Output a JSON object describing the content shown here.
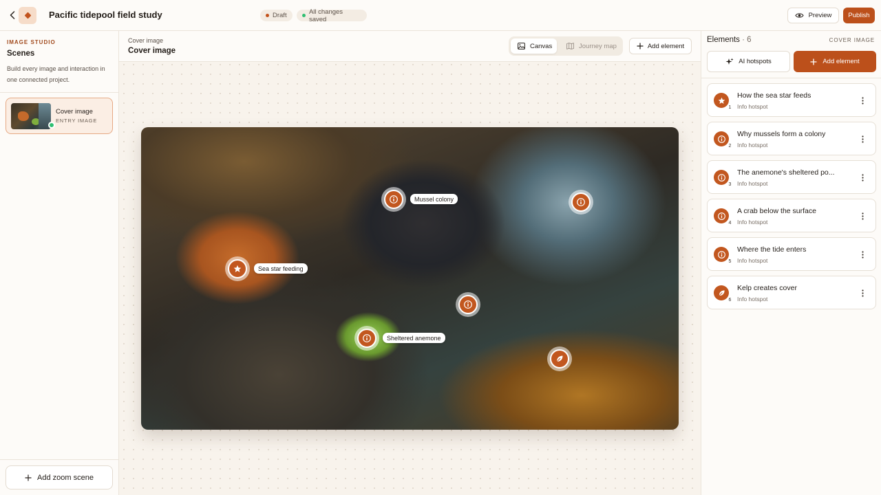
{
  "topbar": {
    "project_title": "Pacific tidepool field study",
    "status_draft": "Draft",
    "status_saved": "All changes saved",
    "preview_label": "Preview",
    "publish_label": "Publish"
  },
  "sidebar": {
    "section_label": "IMAGE STUDIO",
    "heading": "Scenes",
    "description": "Build every image and interaction in one connected project.",
    "scenes": [
      {
        "name": "Cover image",
        "subtitle": "ENTRY IMAGE"
      }
    ],
    "add_zoom_label": "Add zoom scene"
  },
  "canvas_header": {
    "breadcrumb": "Cover image",
    "title": "Cover image",
    "toggle_canvas": "Canvas",
    "toggle_journey": "Journey map",
    "add_element_label": "Add element"
  },
  "hotspots": [
    {
      "label": "Mussel colony",
      "icon": "info-icon"
    },
    {
      "label": "",
      "icon": "info-icon"
    },
    {
      "label": "Sea star feeding",
      "icon": "star-icon"
    },
    {
      "label": "",
      "icon": "info-icon"
    },
    {
      "label": "Sheltered anemone",
      "icon": "info-icon"
    },
    {
      "label": "",
      "icon": "leaf-icon"
    }
  ],
  "elements_panel": {
    "heading": "Elements",
    "count": "· 6",
    "scope": "COVER IMAGE",
    "ai_label": "AI hotspots",
    "add_label": "Add element",
    "items": [
      {
        "number": "1",
        "title": "How the sea star feeds",
        "type": "Info hotspot",
        "icon": "star-icon"
      },
      {
        "number": "2",
        "title": "Why mussels form a colony",
        "type": "Info hotspot",
        "icon": "info-icon"
      },
      {
        "number": "3",
        "title": "The anemone's sheltered po...",
        "type": "Info hotspot",
        "icon": "info-icon"
      },
      {
        "number": "4",
        "title": "A crab below the surface",
        "type": "Info hotspot",
        "icon": "info-icon"
      },
      {
        "number": "5",
        "title": "Where the tide enters",
        "type": "Info hotspot",
        "icon": "info-icon"
      },
      {
        "number": "6",
        "title": "Kelp creates cover",
        "type": "Info hotspot",
        "icon": "leaf-icon"
      }
    ]
  },
  "colors": {
    "accent": "#bc501b",
    "hotspot": "#c2571f",
    "saved_dot": "#2fbf71",
    "draft_dot": "#c2521c"
  }
}
